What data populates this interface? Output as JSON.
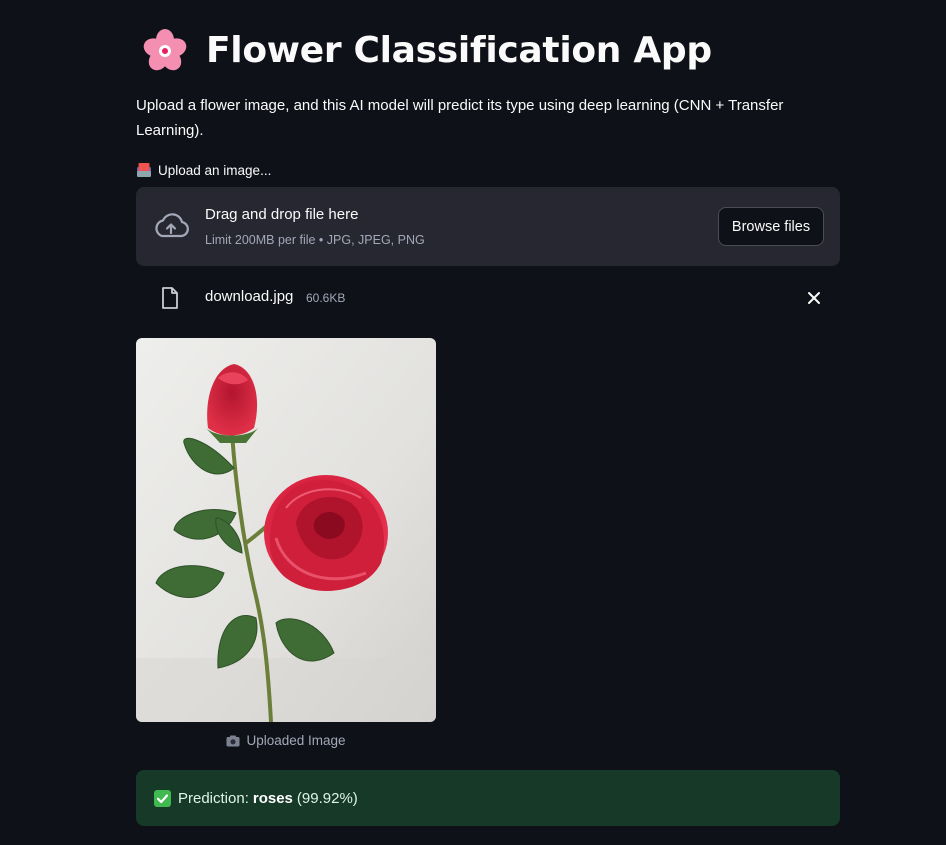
{
  "header": {
    "title_emoji": "cherry-blossom-icon",
    "title": "Flower Classification App",
    "description": "Upload a flower image, and this AI model will predict its type using deep learning (CNN + Transfer Learning)."
  },
  "uploader": {
    "label_icon": "inbox-icon",
    "label": "Upload an image...",
    "drop_title": "Drag and drop file here",
    "drop_hint": "Limit 200MB per file • JPG, JPEG, PNG",
    "browse_label": "Browse files"
  },
  "uploaded_file": {
    "name": "download.jpg",
    "size": "60.6KB"
  },
  "image": {
    "caption_icon": "camera-icon",
    "caption": "Uploaded Image"
  },
  "result": {
    "icon": "check-mark-icon",
    "prefix": "Prediction:",
    "label": "roses",
    "confidence": "(99.92%)",
    "color": "#173928"
  }
}
